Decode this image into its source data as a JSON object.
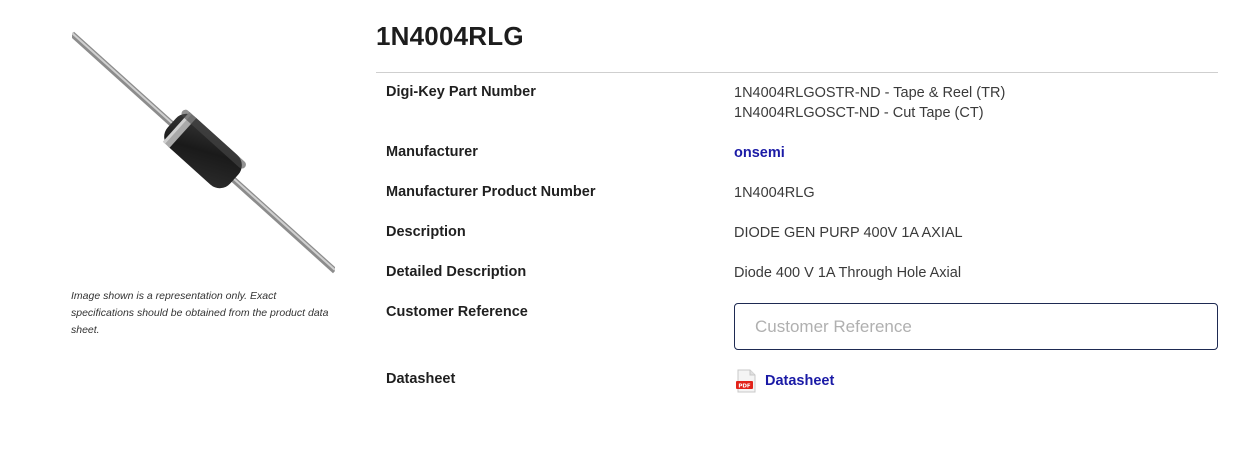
{
  "product": {
    "title": "1N4004RLG",
    "image_caption": "Image shown is a representation only. Exact specifications should be obtained from the product data sheet.",
    "image_icon": "axial-diode-image"
  },
  "attributes": {
    "part_number": {
      "label": "Digi-Key Part Number",
      "values": [
        "1N4004RLGOSTR-ND - Tape & Reel (TR)",
        "1N4004RLGOSCT-ND - Cut Tape (CT)"
      ]
    },
    "manufacturer": {
      "label": "Manufacturer",
      "value": "onsemi"
    },
    "manufacturer_product_number": {
      "label": "Manufacturer Product Number",
      "value": "1N4004RLG"
    },
    "description": {
      "label": "Description",
      "value": "DIODE GEN PURP 400V 1A AXIAL"
    },
    "detailed_description": {
      "label": "Detailed Description",
      "value": "Diode 400 V 1A Through Hole Axial"
    },
    "customer_reference": {
      "label": "Customer Reference",
      "placeholder": "Customer Reference",
      "value": ""
    },
    "datasheet": {
      "label": "Datasheet",
      "link_text": "Datasheet",
      "icon": "pdf-icon",
      "icon_text": "PDF"
    }
  },
  "colors": {
    "link": "#1a1aa6",
    "input_border": "#1e2a52",
    "pdf_red": "#e2231a"
  }
}
